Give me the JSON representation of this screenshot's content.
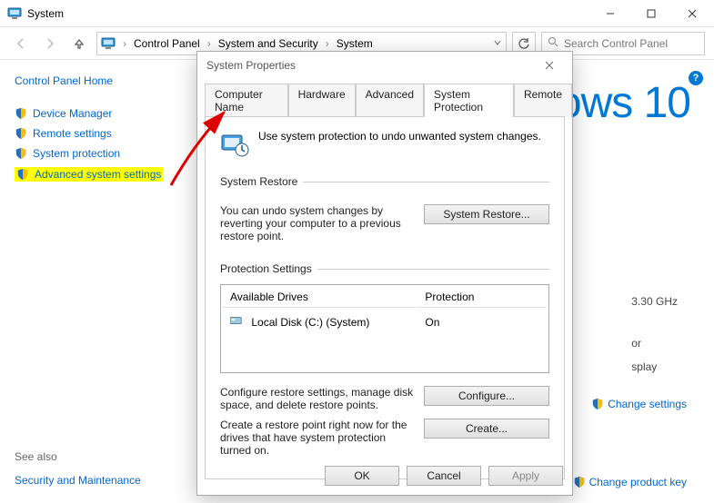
{
  "window": {
    "title": "System"
  },
  "nav": {
    "path": [
      "Control Panel",
      "System and Security",
      "System"
    ],
    "search_placeholder": "Search Control Panel"
  },
  "sidebar": {
    "home": "Control Panel Home",
    "links": [
      {
        "label": "Device Manager"
      },
      {
        "label": "Remote settings"
      },
      {
        "label": "System protection"
      },
      {
        "label": "Advanced system settings"
      }
    ],
    "see_also": "See also",
    "see_also_links": [
      {
        "label": "Security and Maintenance"
      }
    ]
  },
  "right": {
    "brand": "dows 10",
    "spec_ghz": "3.30 GHz",
    "spec_or": "or",
    "spec_splay": "splay",
    "change_settings": "Change settings",
    "change_key": "Change product key"
  },
  "dialog": {
    "title": "System Properties",
    "tabs": [
      "Computer Name",
      "Hardware",
      "Advanced",
      "System Protection",
      "Remote"
    ],
    "intro": "Use system protection to undo unwanted system changes.",
    "sr_legend": "System Restore",
    "sr_text": "You can undo system changes by reverting your computer to a previous restore point.",
    "sr_btn": "System Restore...",
    "ps_legend": "Protection Settings",
    "table": {
      "h1": "Available Drives",
      "h2": "Protection",
      "r1c1": "Local Disk (C:) (System)",
      "r1c2": "On"
    },
    "cfg_text": "Configure restore settings, manage disk space, and delete restore points.",
    "cfg_btn": "Configure...",
    "create_text": "Create a restore point right now for the drives that have system protection turned on.",
    "create_btn": "Create...",
    "ok": "OK",
    "cancel": "Cancel",
    "apply": "Apply"
  }
}
